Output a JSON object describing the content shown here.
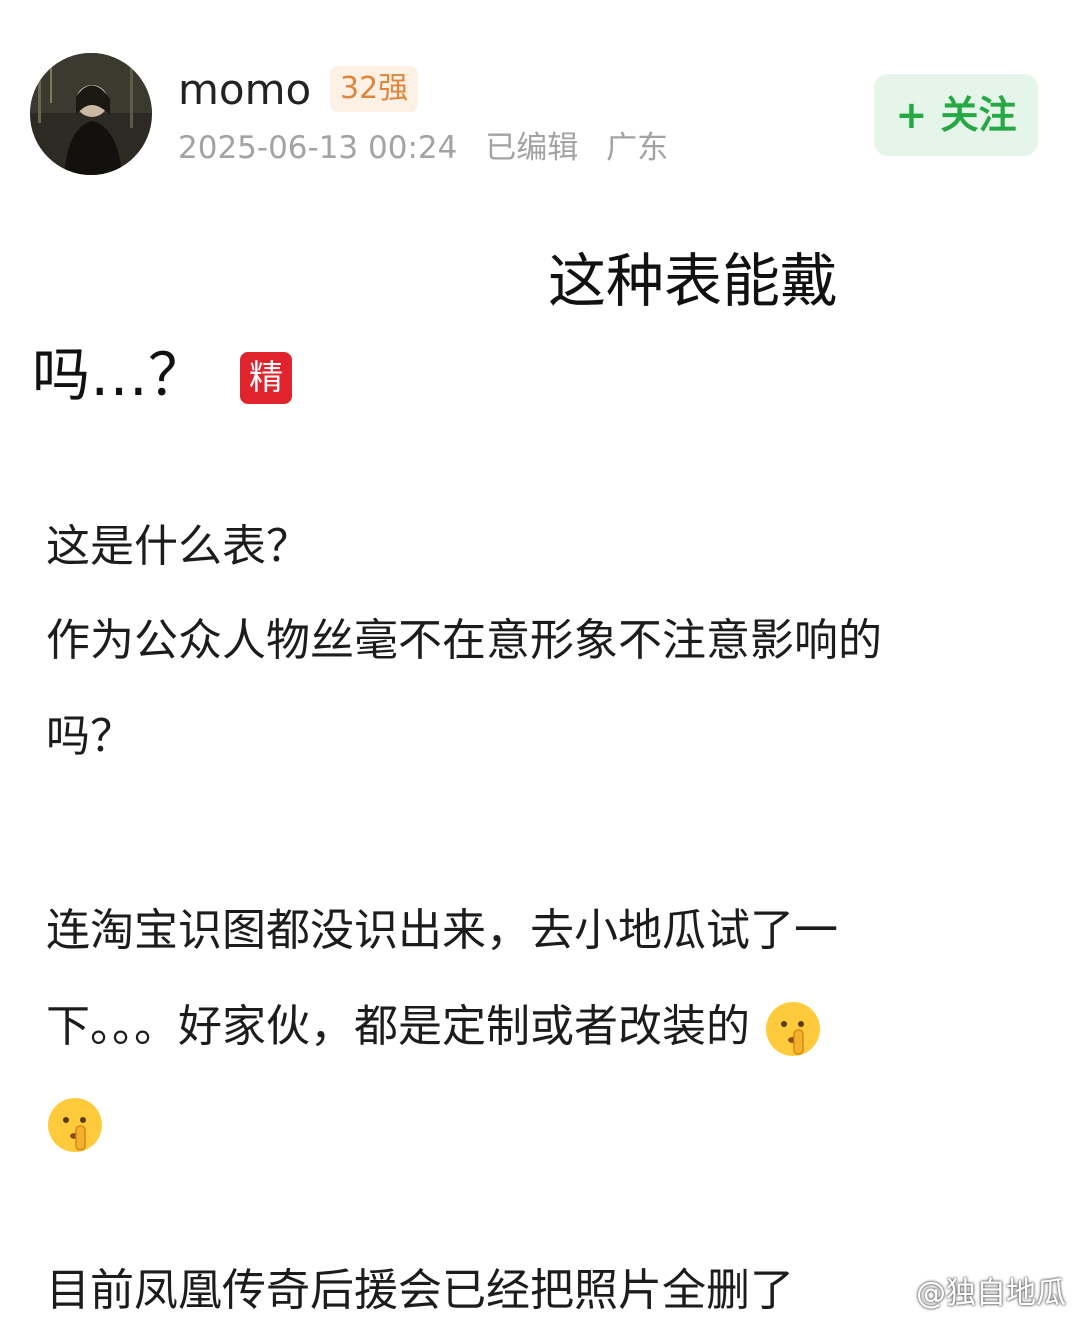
{
  "post": {
    "author": {
      "name": "momo",
      "level_badge": "32强",
      "avatar_icon": "user-avatar-photo"
    },
    "meta": {
      "datetime": "2025-06-13 00:24",
      "edited": "已编辑",
      "location": "广东"
    },
    "follow_label": "+ 关注",
    "title_part1": "这种表能戴",
    "title_part2": "吗…？",
    "featured_badge": "精",
    "body": {
      "line1": "这是什么表？",
      "line2": "作为公众人物丝毫不在意形象不注意影响的",
      "line3": "吗？",
      "line4": "连淘宝识图都没识出来，去小地瓜试了一",
      "line5": "下。。。好家伙，都是定制或者改装的",
      "line6_emoji": "shushing-face-emoji",
      "line7": "目前凤凰传奇后援会已经把照片全删了"
    }
  },
  "watermark": "@独自地瓜",
  "colors": {
    "follow_text": "#26a845",
    "follow_bg": "#e6f5e9",
    "badge_text": "#e0853c",
    "featured_bg": "#e0232d",
    "meta_text": "#a3a3a3"
  }
}
